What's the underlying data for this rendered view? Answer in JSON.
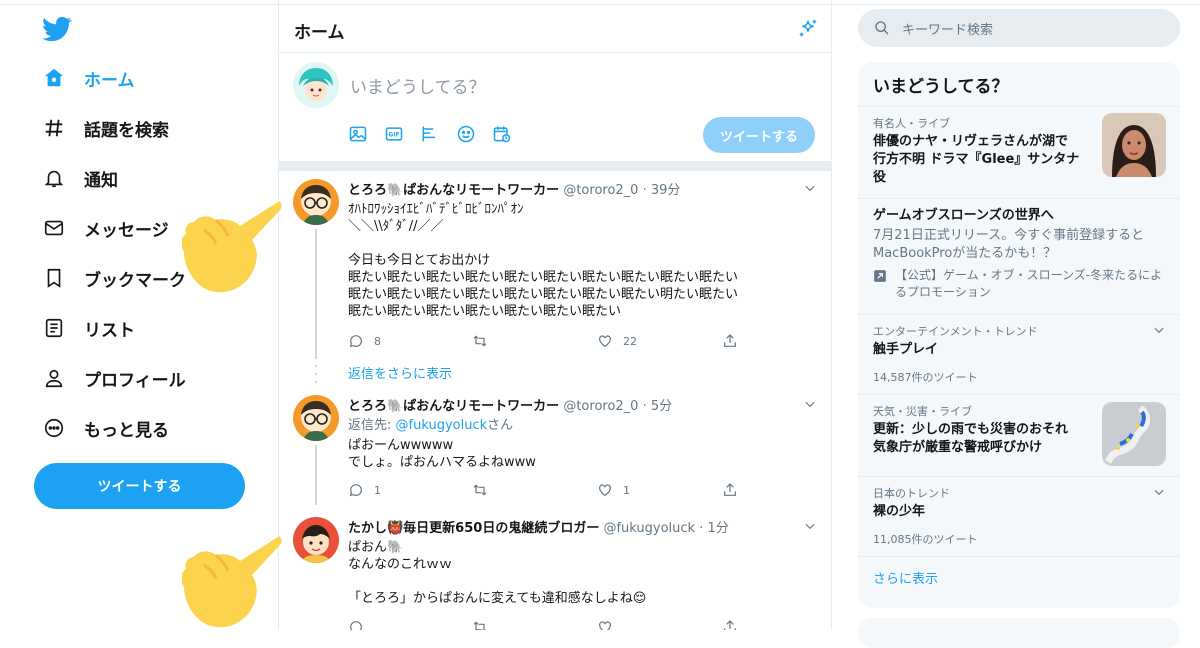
{
  "nav": {
    "items": [
      {
        "label": "ホーム",
        "icon": "home-icon",
        "active": true
      },
      {
        "label": "話題を検索",
        "icon": "hashtag-icon"
      },
      {
        "label": "通知",
        "icon": "bell-icon"
      },
      {
        "label": "メッセージ",
        "icon": "mail-icon"
      },
      {
        "label": "ブックマーク",
        "icon": "bookmark-icon"
      },
      {
        "label": "リスト",
        "icon": "list-icon"
      },
      {
        "label": "プロフィール",
        "icon": "profile-icon"
      },
      {
        "label": "もっと見る",
        "icon": "more-icon"
      }
    ],
    "tweet_button": "ツイートする"
  },
  "header": {
    "title": "ホーム"
  },
  "composer": {
    "placeholder": "いまどうしてる？",
    "tweet_button": "ツイートする"
  },
  "tweets": [
    {
      "name": "とろろ🐘ぱおんなリモートワーカー",
      "handle": "@tororo2_0",
      "time": "39分",
      "body": "ｵﾊﾄﾛﾜｯｼｮｲｴﾋﾞﾊﾞﾃﾞﾋﾞﾛﾋﾞﾛﾝﾊﾟｵﾝ\n＼＼\\\\ﾀﾞﾀﾞ//／／\n\n今日も今日とてお出かけ\n眠たい眠たい眠たい眠たい眠たい眠たい眠たい眠たい眠たい眠たい\n眠たい眠たい眠たい眠たい眠たい眠たい眠たい眠たい明たい眠たい\n眠たい眠たい眠たい眠たい眠たい眠たい眠たい",
      "replies": "8",
      "retweets": "",
      "likes": "22"
    },
    {
      "name": "とろろ🐘ぱおんなリモートワーカー",
      "handle": "@tororo2_0",
      "time": "5分",
      "reply_prefix": "返信先:",
      "reply_to": "@fukugyoluck",
      "reply_suffix": "さん",
      "body": "ぱおーんwwwww\nでしょ。ぱおんハマるよねwww",
      "replies": "1",
      "retweets": "",
      "likes": "1"
    },
    {
      "name": "たかし👹毎日更新650日の鬼継続ブロガー",
      "handle": "@fukugyoluck",
      "time": "1分",
      "body": "ぱおん🐘\nなんなのこれｗｗ\n\n「とろろ」からぱおんに変えても違和感なしよね😌"
    }
  ],
  "show_more_replies": "返信をさらに表示",
  "search": {
    "placeholder": "キーワード検索"
  },
  "trends": {
    "title": "いまどうしてる？",
    "items": [
      {
        "category": "有名人・ライブ",
        "title": "俳優のナヤ・リヴェラさんが湖で\n行方不明 ドラマ『Glee』サンタナ\n役"
      },
      {
        "title": "ゲームオブスローンズの世界へ",
        "description": "7月21日正式リリース。今すぐ事前登録すると\nMacBookProが当たるかも！？",
        "promo": "【公式】ゲーム・オブ・スローンズ-冬来たるによ\nるプロモーション"
      },
      {
        "category": "エンターテインメント・トレンド",
        "title": "触手プレイ",
        "count": "14,587件のツイート"
      },
      {
        "category": "天気・災害・ライブ",
        "title": "更新：少しの雨でも災害のおそれ\n気象庁が厳重な警戒呼びかけ"
      },
      {
        "category": "日本のトレンド",
        "title": "裸の少年",
        "count": "11,085件のツイート"
      }
    ],
    "show_more": "さらに表示"
  },
  "colors": {
    "accent": "#1da1f2",
    "accent_disabled": "#8ed0f9",
    "text": "#14171a",
    "muted": "#657786",
    "border": "#e6ecf0",
    "panel": "#f5f8fa",
    "hand": "#fcd34d"
  }
}
